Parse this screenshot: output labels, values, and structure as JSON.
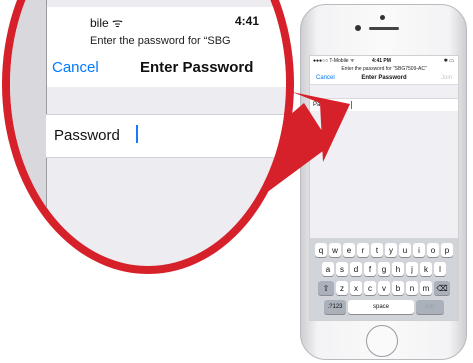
{
  "magnified": {
    "status_carrier": "bile ᯤ",
    "status_time": "4:41",
    "prompt": "Enter the password for “SBG",
    "cancel_label": "Cancel",
    "title": "Enter Password",
    "password_label": "Password"
  },
  "phone": {
    "status": {
      "carrier": "●●●○○ T-Mobile ᯤ",
      "time": "4:41 PM",
      "battery": "✱ ▭"
    },
    "prompt": "Enter the password for “SBG7509-AC”",
    "nav": {
      "cancel_label": "Cancel",
      "title": "Enter Password",
      "join_label": "Join"
    },
    "password_label": "Password",
    "keyboard": {
      "row1": [
        "q",
        "w",
        "e",
        "r",
        "t",
        "y",
        "u",
        "i",
        "o",
        "p"
      ],
      "row2": [
        "a",
        "s",
        "d",
        "f",
        "g",
        "h",
        "j",
        "k",
        "l"
      ],
      "row3": [
        "z",
        "x",
        "c",
        "v",
        "b",
        "n",
        "m"
      ],
      "shift_icon": "⇧",
      "delete_icon": "⌫",
      "numbers_label": ".?123",
      "space_label": "space",
      "join_label": "Join"
    }
  },
  "colors": {
    "accent": "#007aff",
    "magnifier_ring": "#d6202a"
  }
}
